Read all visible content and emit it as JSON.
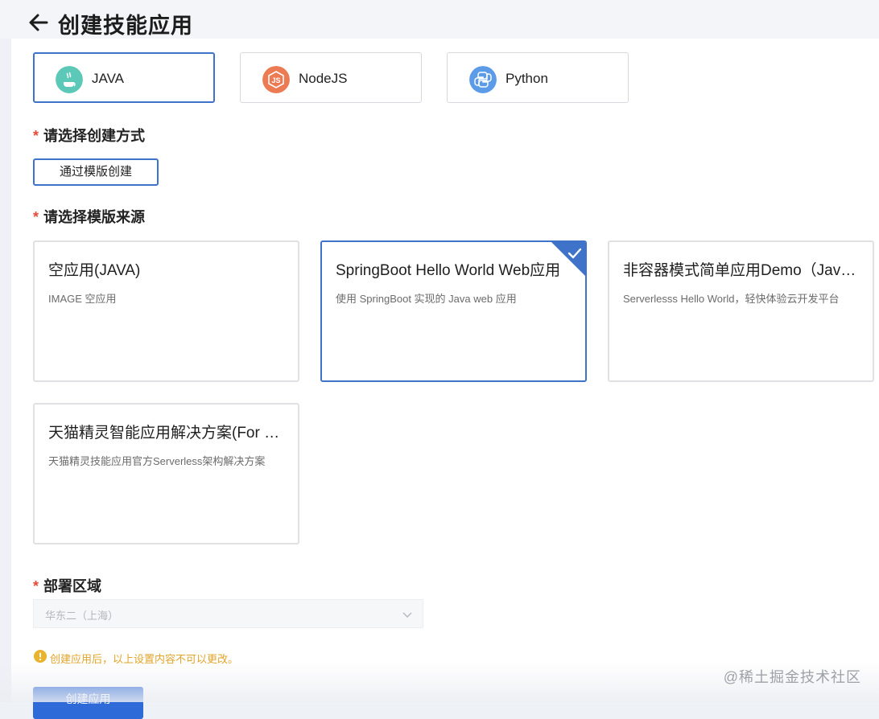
{
  "header": {
    "title": "创建技能应用"
  },
  "languages": [
    {
      "label": "JAVA",
      "icon": "java-icon",
      "color": "#5cc8b8",
      "selected": true
    },
    {
      "label": "NodeJS",
      "icon": "nodejs-icon",
      "color": "#ec7a52",
      "selected": false
    },
    {
      "label": "Python",
      "icon": "python-icon",
      "color": "#5b9be8",
      "selected": false
    }
  ],
  "method": {
    "required_mark": "*",
    "label": "请选择创建方式",
    "button_label": "通过模版创建"
  },
  "template_source": {
    "required_mark": "*",
    "label": "请选择模版来源"
  },
  "templates": [
    {
      "title": "空应用(JAVA)",
      "desc": "IMAGE 空应用",
      "selected": false
    },
    {
      "title": "SpringBoot Hello World Web应用",
      "desc": "使用 SpringBoot 实现的 Java web 应用",
      "selected": true
    },
    {
      "title": "非容器模式简单应用Demo（Jav…",
      "desc": "Serverlesss Hello World，轻快体验云开发平台",
      "selected": false
    },
    {
      "title": "天猫精灵智能应用解决方案(For …",
      "desc": "天猫精灵技能应用官方Serverless架构解决方案",
      "selected": false
    }
  ],
  "region": {
    "required_mark": "*",
    "label": "部署区域",
    "value": "华东二（上海）"
  },
  "warning": {
    "text": "创建应用后，以上设置内容不可以更改。"
  },
  "footer": {
    "create_label": "创建应用"
  },
  "watermark": "@稀土掘金技术社区",
  "colors": {
    "accent": "#3f72c9",
    "primary_button": "#2f6bd8",
    "required": "#e44b3a",
    "warning": "#e2a42a"
  }
}
